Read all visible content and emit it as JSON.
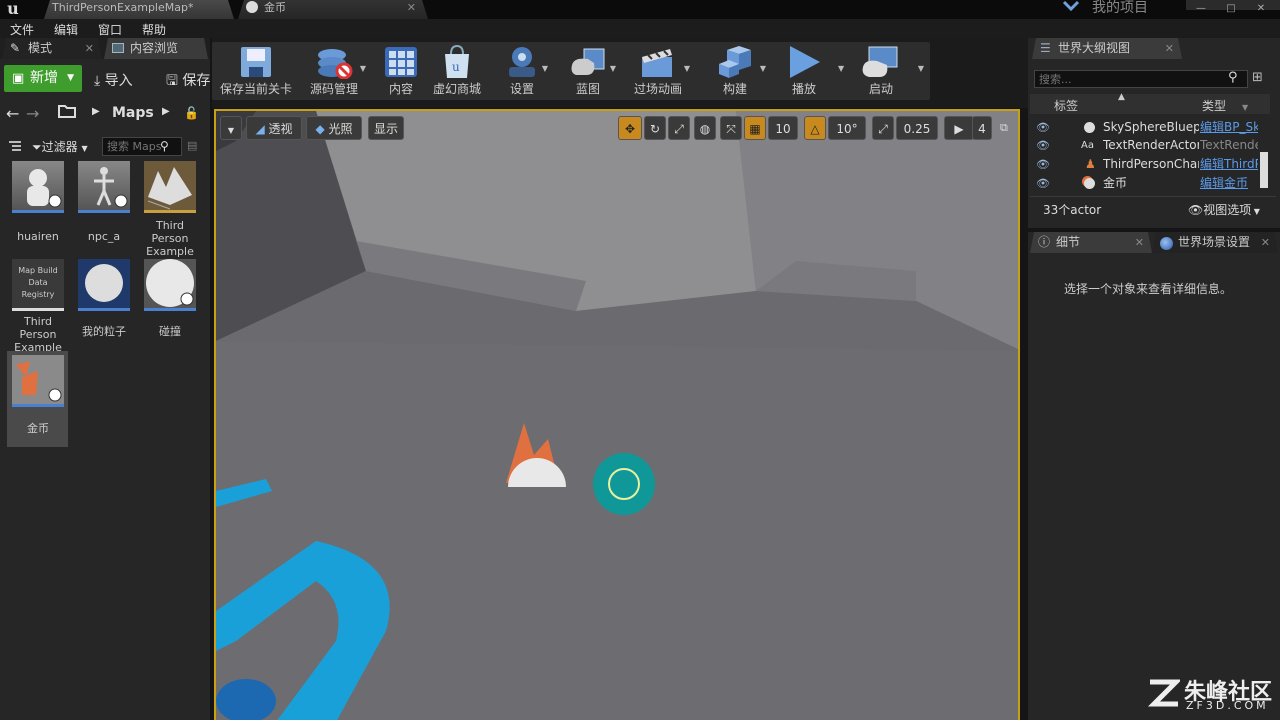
{
  "window": {
    "tabs": [
      {
        "label": "ThirdPersonExampleMap*"
      },
      {
        "label": "金币"
      }
    ],
    "project_name": "我的项目",
    "controls": {
      "minimize": "—",
      "maximize": "□",
      "close": "✕"
    }
  },
  "menu": [
    "文件",
    "编辑",
    "窗口",
    "帮助"
  ],
  "left_panel": {
    "tabs": [
      {
        "label": "模式"
      },
      {
        "label": "内容浏览"
      }
    ],
    "new_button": "新增",
    "import_button": "导入",
    "save_button": "保存",
    "path": "Maps",
    "filter_label": "过滤器",
    "search_placeholder": "搜索 Maps",
    "assets": [
      {
        "label": "huairen"
      },
      {
        "label": "npc_a"
      },
      {
        "label": "Third Person Example"
      },
      {
        "label": "Third Person Example",
        "thumb_text": "Map Build Data Registry"
      },
      {
        "label": "我的粒子"
      },
      {
        "label": "碰撞"
      },
      {
        "label": "金币"
      }
    ]
  },
  "toolbar": {
    "buttons": [
      {
        "label": "保存当前关卡",
        "icon": "save-icon"
      },
      {
        "label": "源码管理",
        "icon": "source-control-icon"
      },
      {
        "label": "内容",
        "icon": "content-icon"
      },
      {
        "label": "虚幻商城",
        "icon": "marketplace-icon"
      },
      {
        "label": "设置",
        "icon": "settings-icon"
      },
      {
        "label": "蓝图",
        "icon": "blueprint-icon"
      },
      {
        "label": "过场动画",
        "icon": "cinematics-icon"
      },
      {
        "label": "构建",
        "icon": "build-icon"
      },
      {
        "label": "播放",
        "icon": "play-icon"
      },
      {
        "label": "启动",
        "icon": "launch-icon"
      }
    ]
  },
  "viewport": {
    "perspective": "透视",
    "lighting": "光照",
    "show": "显示",
    "grid_snap": "10",
    "rotation_snap": "10°",
    "scale_snap": "0.25",
    "camera_speed": "4",
    "accent": "#c9a013"
  },
  "outliner": {
    "tab": "世界大纲视图",
    "search_placeholder": "搜索...",
    "col_label": "标签",
    "col_type": "类型",
    "rows": [
      {
        "name": "SkySphereBlueprint",
        "type": "编辑BP_Sky",
        "icon": "sphere-icon"
      },
      {
        "name": "TextRenderActor",
        "type": "TextRenderActor",
        "icon": "text-icon"
      },
      {
        "name": "ThirdPersonCharacter",
        "type": "编辑ThirdPerson",
        "icon": "character-icon"
      },
      {
        "name": "金币",
        "type": "编辑金币",
        "icon": "sphere-icon"
      }
    ],
    "actor_count": "33个actor",
    "view_options": "视图选项"
  },
  "details": {
    "tabs": [
      {
        "label": "细节"
      },
      {
        "label": "世界场景设置"
      }
    ],
    "empty_message": "选择一个对象来查看详细信息。"
  },
  "watermark": {
    "brand": "朱峰社区",
    "url": "ZF3D.COM"
  }
}
